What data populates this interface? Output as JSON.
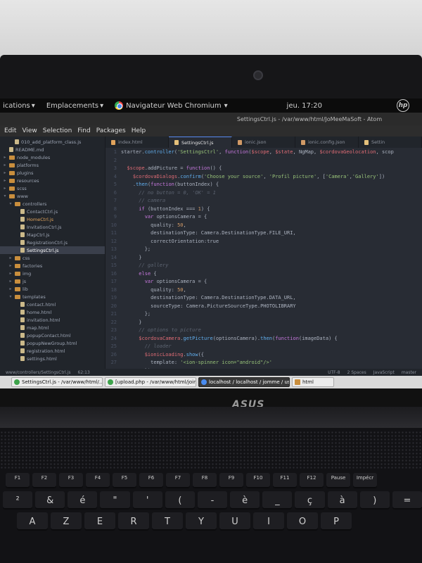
{
  "topbar": {
    "applications_label": "ications",
    "places_label": "Emplacements",
    "browser_label": "Navigateur Web Chromium",
    "clock": "jeu. 17:20",
    "hp_logo": "hp"
  },
  "window": {
    "title": "SettingsCtrl.js - /var/www/html/JoMeeMaSoft - Atom"
  },
  "menubar": [
    "Edit",
    "View",
    "Selection",
    "Find",
    "Packages",
    "Help"
  ],
  "tree": [
    {
      "label": "010_add_platform_class.js",
      "type": "file",
      "indent": 1
    },
    {
      "label": "README.md",
      "type": "file",
      "indent": 0
    },
    {
      "label": "node_modules",
      "type": "folder",
      "indent": 0
    },
    {
      "label": "platforms",
      "type": "folder",
      "indent": 0
    },
    {
      "label": "plugins",
      "type": "folder",
      "indent": 0
    },
    {
      "label": "resources",
      "type": "folder",
      "indent": 0
    },
    {
      "label": "scss",
      "type": "folder",
      "indent": 0
    },
    {
      "label": "www",
      "type": "folder",
      "indent": 0,
      "open": true
    },
    {
      "label": "controllers",
      "type": "folder",
      "indent": 1,
      "open": true
    },
    {
      "label": "ContactCtrl.js",
      "type": "file",
      "indent": 2
    },
    {
      "label": "HomeCtrl.js",
      "type": "file",
      "indent": 2,
      "orange": true
    },
    {
      "label": "InvitationCtrl.js",
      "type": "file",
      "indent": 2
    },
    {
      "label": "MapCtrl.js",
      "type": "file",
      "indent": 2
    },
    {
      "label": "RegistrationCtrl.js",
      "type": "file",
      "indent": 2
    },
    {
      "label": "SettingsCtrl.js",
      "type": "file",
      "indent": 2,
      "selected": true
    },
    {
      "label": "css",
      "type": "folder",
      "indent": 1
    },
    {
      "label": "factories",
      "type": "folder",
      "indent": 1
    },
    {
      "label": "img",
      "type": "folder",
      "indent": 1
    },
    {
      "label": "js",
      "type": "folder",
      "indent": 1
    },
    {
      "label": "lib",
      "type": "folder",
      "indent": 1
    },
    {
      "label": "templates",
      "type": "folder",
      "indent": 1,
      "open": true
    },
    {
      "label": "contact.html",
      "type": "file",
      "indent": 2
    },
    {
      "label": "home.html",
      "type": "file",
      "indent": 2
    },
    {
      "label": "invitation.html",
      "type": "file",
      "indent": 2
    },
    {
      "label": "map.html",
      "type": "file",
      "indent": 2
    },
    {
      "label": "popupContact.html",
      "type": "file",
      "indent": 2
    },
    {
      "label": "popupNewGroup.html",
      "type": "file",
      "indent": 2
    },
    {
      "label": "registration.html",
      "type": "file",
      "indent": 2
    },
    {
      "label": "settings.html",
      "type": "file",
      "indent": 2
    }
  ],
  "tabs": [
    {
      "label": "index.html",
      "icon_color": "#e0a35c"
    },
    {
      "label": "SettingsCtrl.js",
      "icon_color": "#e5c07b",
      "active": true
    },
    {
      "label": "ionic.json",
      "icon_color": "#d19a66"
    },
    {
      "label": "ionic.config.json",
      "icon_color": "#d19a66"
    },
    {
      "label": "Settin",
      "icon_color": "#e5c07b"
    }
  ],
  "code_lines": [
    [
      "1",
      "starter.controller('SettingsCtrl', function($scope, $state, NgMap, $cordovaGeolocation, scop"
    ],
    [
      "2",
      ""
    ],
    [
      "3",
      "  $scope.addPicture = function() {"
    ],
    [
      "4",
      "    $cordovaDialogs.confirm('Choose your source', 'Profil picture', ['Camera','Gallery'])"
    ],
    [
      "5",
      "    .then(function(buttonIndex) {"
    ],
    [
      "6",
      "      // no button = 0, 'OK' = 1"
    ],
    [
      "7",
      "      // camera"
    ],
    [
      "8",
      "      if (buttonIndex === 1) {"
    ],
    [
      "9",
      "        var optionsCamera = {"
    ],
    [
      "10",
      "          quality: 50,"
    ],
    [
      "11",
      "          destinationType: Camera.DestinationType.FILE_URI,"
    ],
    [
      "12",
      "          correctOrientation:true"
    ],
    [
      "13",
      "        };"
    ],
    [
      "14",
      "      }"
    ],
    [
      "15",
      "      // gallery"
    ],
    [
      "16",
      "      else {"
    ],
    [
      "17",
      "        var optionsCamera = {"
    ],
    [
      "18",
      "          quality: 50,"
    ],
    [
      "19",
      "          destinationType: Camera.DestinationType.DATA_URL,"
    ],
    [
      "20",
      "          sourceType: Camera.PictureSourceType.PHOTOLIBRARY"
    ],
    [
      "21",
      "        };"
    ],
    [
      "22",
      "      }"
    ],
    [
      "23",
      "      // options to picture"
    ],
    [
      "24",
      "      $cordovaCamera.getPicture(optionsCamera).then(function(imageData) {"
    ],
    [
      "25",
      "        // loader"
    ],
    [
      "26",
      "        $ionicLoading.show({"
    ],
    [
      "27",
      "          template: '<ion-spinner icon=\"android\"/>'"
    ],
    [
      "28",
      "        });"
    ]
  ],
  "statusbar": {
    "path": "www/controllers/SettingsCtrl.js",
    "position": "62:13",
    "encoding": "UTF-8",
    "indent": "2 Spaces",
    "grammar": "JavaScript",
    "branch": "master"
  },
  "taskbar": [
    {
      "label": "SettingsCtrl.js - /var/www/html/...",
      "icon": "atom"
    },
    {
      "label": "[upload.php - /var/www/html/join...",
      "icon": "atom"
    },
    {
      "label": "localhost / localhost / jomme / us...",
      "icon": "chromium",
      "active": true
    },
    {
      "label": "html",
      "icon": "folder"
    }
  ],
  "hardware": {
    "brand": "ASUS",
    "fn_keys": [
      "F1",
      "F2",
      "F3",
      "F4",
      "F5",
      "F6",
      "F7",
      "F8",
      "F9",
      "F10",
      "F11",
      "F12",
      "Pause",
      "Impécr"
    ],
    "row1": [
      "²",
      "&",
      "é",
      "\"",
      "'",
      "(",
      "-",
      "è",
      "_",
      "ç",
      "à",
      ")",
      "="
    ],
    "row2": [
      "A",
      "Z",
      "E",
      "R",
      "T",
      "Y",
      "U",
      "I",
      "O",
      "P"
    ]
  }
}
